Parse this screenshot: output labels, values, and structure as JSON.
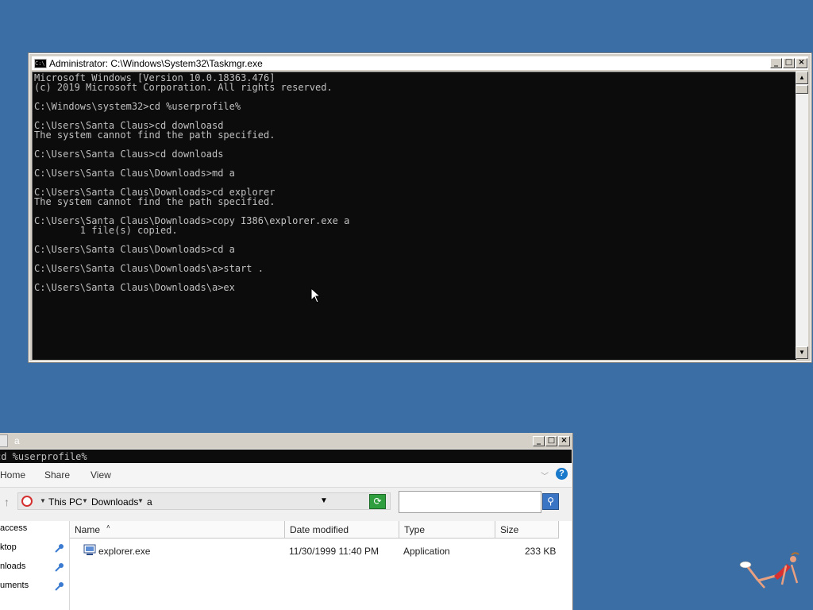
{
  "console": {
    "title": "Administrator: C:\\Windows\\System32\\Taskmgr.exe",
    "lines": [
      "Microsoft Windows [Version 10.0.18363.476]",
      "(c) 2019 Microsoft Corporation. All rights reserved.",
      "",
      "C:\\Windows\\system32>cd %userprofile%",
      "",
      "C:\\Users\\Santa Claus>cd downloasd",
      "The system cannot find the path specified.",
      "",
      "C:\\Users\\Santa Claus>cd downloads",
      "",
      "C:\\Users\\Santa Claus\\Downloads>md a",
      "",
      "C:\\Users\\Santa Claus\\Downloads>cd explorer",
      "The system cannot find the path specified.",
      "",
      "C:\\Users\\Santa Claus\\Downloads>copy I386\\explorer.exe a",
      "        1 file(s) copied.",
      "",
      "C:\\Users\\Santa Claus\\Downloads>cd a",
      "",
      "C:\\Users\\Santa Claus\\Downloads\\a>start .",
      "",
      "C:\\Users\\Santa Claus\\Downloads\\a>ex"
    ]
  },
  "explorer": {
    "title": "a",
    "cmdline": "cd %userprofile%",
    "ribbon_tabs": [
      "Home",
      "Share",
      "View"
    ],
    "breadcrumb": [
      "This PC",
      "Downloads",
      "a"
    ],
    "search_placeholder": "",
    "nav_items": [
      {
        "label": "access",
        "pinned": false
      },
      {
        "label": "ktop",
        "pinned": true
      },
      {
        "label": "nloads",
        "pinned": true
      },
      {
        "label": "uments",
        "pinned": true
      }
    ],
    "columns": {
      "name": "Name",
      "date": "Date modified",
      "type": "Type",
      "size": "Size"
    },
    "files": [
      {
        "name": "explorer.exe",
        "date": "11/30/1999 11:40 PM",
        "type": "Application",
        "size": "233 KB"
      }
    ]
  },
  "colors": {
    "desktop": "#3a6ea5",
    "console_bg": "#0c0c0c",
    "console_fg": "#c0c0c0",
    "window_chrome": "#d4d0c8"
  }
}
